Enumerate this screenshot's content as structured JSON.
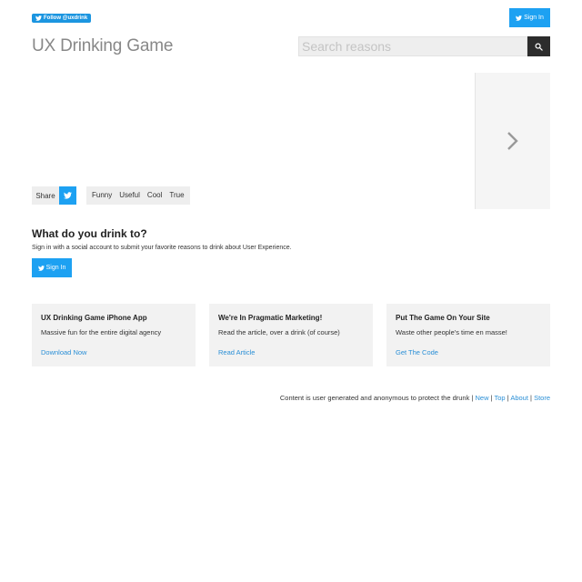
{
  "topbar": {
    "follow_label": "Follow @uxdrink",
    "signin_label": "Sign In"
  },
  "header": {
    "title": "UX Drinking Game",
    "search_placeholder": "Search reasons"
  },
  "share": {
    "label": "Share"
  },
  "votes": [
    "Funny",
    "Useful",
    "Cool",
    "True"
  ],
  "cta": {
    "heading": "What do you drink to?",
    "text": "Sign in with a social account to submit your favorite reasons to drink about User Experience.",
    "signin_label": "Sign In"
  },
  "cards": [
    {
      "title": "UX Drinking Game iPhone App",
      "text": "Massive fun for the entire digital agency",
      "link": "Download Now"
    },
    {
      "title": "We're In Pragmatic Marketing!",
      "text": "Read the article, over a drink (of course)",
      "link": "Read Article"
    },
    {
      "title": "Put The Game On Your Site",
      "text": "Waste other people's time en masse!",
      "link": "Get The Code"
    }
  ],
  "footer": {
    "text": "Content is user generated and anonymous to protect the drunk",
    "links": [
      "New",
      "Top",
      "About",
      "Store"
    ],
    "separator": "|"
  },
  "colors": {
    "accent": "#1da1f2",
    "link": "#2a8fd6",
    "panel": "#f2f2f2",
    "search_button": "#2c2c2c"
  }
}
